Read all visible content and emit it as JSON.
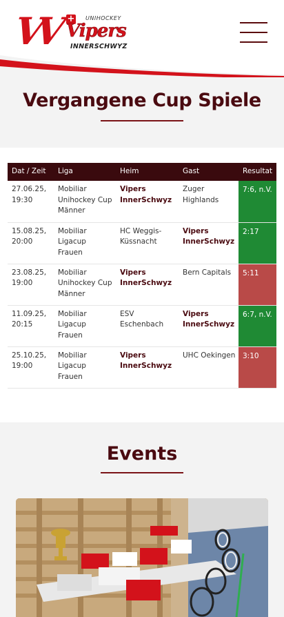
{
  "header": {
    "logo": {
      "top_text": "UNIHOCKEY",
      "name": "Vipers",
      "bottom_text": "INNERSCHWYZ"
    },
    "menu_icon": "hamburger-menu-icon",
    "colors": {
      "brand_red": "#d3121b",
      "dark_maroon": "#3a0a0e"
    }
  },
  "cup_games": {
    "title": "Vergangene Cup Spiele",
    "columns": [
      "Dat / Zeit",
      "Liga",
      "Heim",
      "Gast",
      "Resultat"
    ],
    "rows": [
      {
        "date": "27.06.25, 19:30",
        "league": "Mobiliar Unihockey Cup Männer",
        "home": "Vipers InnerSchwyz",
        "guest": "Zuger Highlands",
        "result": "7:6, n.V.",
        "outcome": "win"
      },
      {
        "date": "15.08.25, 20:00",
        "league": "Mobiliar Ligacup Frauen",
        "home": "HC Weggis-Küssnacht",
        "guest": "Vipers InnerSchwyz",
        "result": "2:17",
        "outcome": "win"
      },
      {
        "date": "23.08.25, 19:00",
        "league": "Mobiliar Unihockey Cup Männer",
        "home": "Vipers InnerSchwyz",
        "guest": "Bern Capitals",
        "result": "5:11",
        "outcome": "loss"
      },
      {
        "date": "11.09.25, 20:15",
        "league": "Mobiliar Ligacup Frauen",
        "home": "ESV Eschenbach",
        "guest": "Vipers InnerSchwyz",
        "result": "6:7, n.V.",
        "outcome": "win"
      },
      {
        "date": "25.10.25, 19:00",
        "league": "Mobiliar Ligacup Frauen",
        "home": "Vipers InnerSchwyz",
        "guest": "UHC Oekingen",
        "result": "3:10",
        "outcome": "loss"
      }
    ]
  },
  "events": {
    "title": "Events"
  }
}
